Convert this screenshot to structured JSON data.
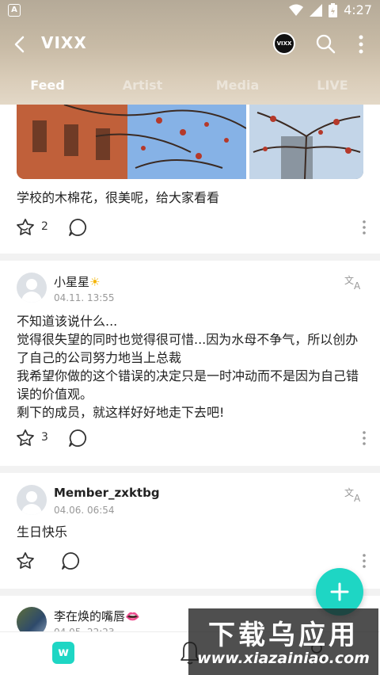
{
  "status": {
    "time": "4:27"
  },
  "header": {
    "title": "VIXX",
    "logo_text": "VIXX",
    "tabs": [
      {
        "label": "Feed",
        "active": true
      },
      {
        "label": "Artist",
        "active": false
      },
      {
        "label": "Media",
        "active": false
      },
      {
        "label": "LIVE",
        "active": false
      }
    ]
  },
  "posts": [
    {
      "text": "学校的木棉花，很美呢，给大家看看",
      "likes": "2"
    },
    {
      "author": "小星星",
      "author_emoji": "☀",
      "date": "04.11. 13:55",
      "lines": [
        "不知道该说什么...",
        "觉得很失望的同时也觉得很可惜...因为水母不争气，所以创办",
        "了自己的公司努力地当上总裁",
        "我希望你做的这个错误的决定只是一时冲动而不是因为自己错",
        "误的价值观。",
        "剩下的成员，就这样好好地走下去吧!"
      ],
      "likes": "3"
    },
    {
      "author": "Member_zxktbg",
      "date": "04.06. 06:54",
      "text": "生日快乐"
    },
    {
      "author": "李在焕的嘴唇",
      "author_emoji": "👄",
      "date": "04.05. 22:23"
    }
  ],
  "watermark": {
    "title": "下载乌应用",
    "url": "www.xiazainiao.com"
  },
  "colors": {
    "accent": "#1ed6c4"
  },
  "icons": [
    "back-icon",
    "search-icon",
    "more-vert-icon",
    "like-icon",
    "comment-icon",
    "translate-icon",
    "plus-icon",
    "home-icon",
    "bell-icon",
    "profile-icon"
  ]
}
